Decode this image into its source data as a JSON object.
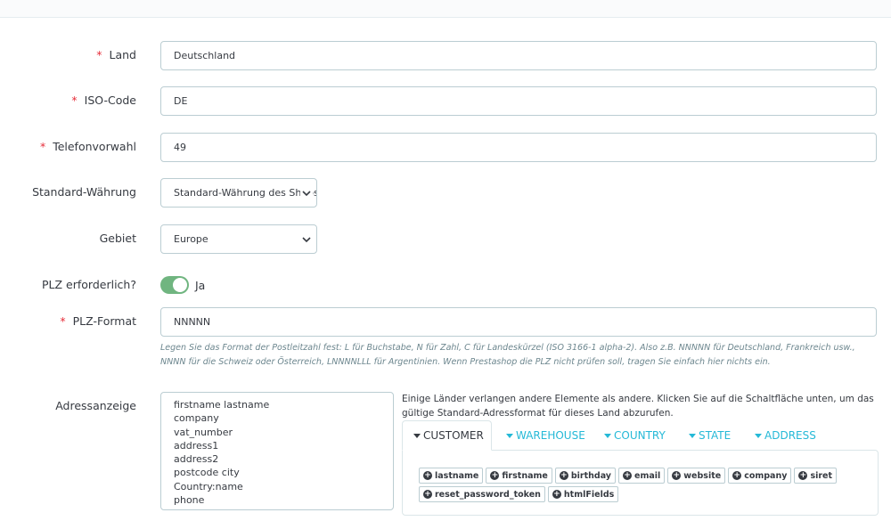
{
  "form": {
    "land": {
      "label": "Land",
      "value": "Deutschland"
    },
    "iso": {
      "label": "ISO-Code",
      "value": "DE"
    },
    "phone": {
      "label": "Telefonvorwahl",
      "value": "49"
    },
    "currency": {
      "label": "Standard-Währung",
      "value": "Standard-Währung des Shops"
    },
    "zone": {
      "label": "Gebiet",
      "value": "Europe"
    },
    "zip_required": {
      "label": "PLZ erforderlich?",
      "value": "Ja",
      "on": true
    },
    "zip_format": {
      "label": "PLZ-Format",
      "value": "NNNNN",
      "help": "Legen Sie das Format der Postleitzahl fest: L für Buchstabe, N für Zahl, C für Landeskürzel (ISO 3166-1 alpha-2). Also z.B. NNNNN für Deutschland, Frankreich usw., NNNN für die Schweiz oder Österreich, LNNNNLLL für Argentinien. Wenn Prestashop die PLZ nicht prüfen soll, tragen Sie einfach hier nichts ein."
    },
    "address": {
      "label": "Adressanzeige",
      "lines": [
        "firstname lastname",
        "company",
        "vat_number",
        "address1",
        "address2",
        "postcode city",
        "Country:name",
        "phone"
      ],
      "note": "Einige Länder verlangen andere Elemente als andere. Klicken Sie auf die Schaltfläche unten, um das gültige Standard-Adressformat für dieses Land abzurufen."
    }
  },
  "required_mark": "*",
  "tabs": [
    "CUSTOMER",
    "WAREHOUSE",
    "COUNTRY",
    "STATE",
    "ADDRESS"
  ],
  "chips": [
    "lastname",
    "firstname",
    "birthday",
    "email",
    "website",
    "company",
    "siret",
    "reset_password_token",
    "htmlFields"
  ],
  "colors": {
    "toggle_on": "#70b580",
    "link": "#25b9d7",
    "required": "#e62e3a"
  }
}
